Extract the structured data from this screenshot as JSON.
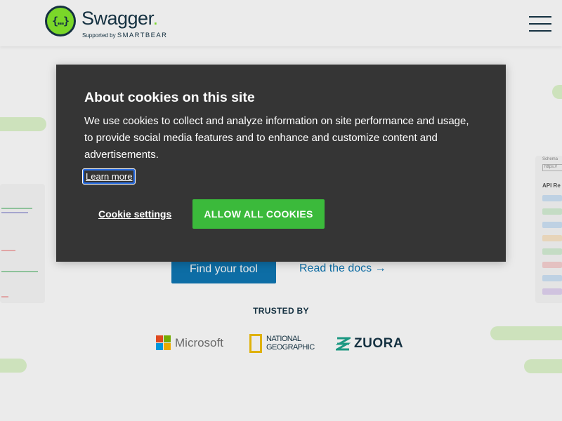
{
  "header": {
    "logo_glyph": "{…}",
    "logo_word": "Swagger",
    "logo_tm": ".",
    "supported_by": "Supported by",
    "smartbear": "SMARTBEAR"
  },
  "hero": {
    "find_tool_label": "Find your tool",
    "read_docs_label": "Read the docs",
    "read_docs_arrow": "→"
  },
  "trusted": {
    "heading": "TRUSTED BY",
    "logos": {
      "microsoft": "Microsoft",
      "natgeo_line1": "NATIONAL",
      "natgeo_line2": "GEOGRAPHIC",
      "zuora": "ZUORA"
    }
  },
  "side_card_right": {
    "label_top": "Schema",
    "field_text": "https://",
    "section_title": "API Re"
  },
  "cookie_banner": {
    "title": "About cookies on this site",
    "body": "We use cookies to collect and analyze information on site performance and usage, to provide social media features and to enhance and customize content and advertisements.",
    "learn_more": "Learn more",
    "settings_label": "Cookie settings",
    "allow_label": "ALLOW ALL COOKIES"
  },
  "colors": {
    "brand_green": "#85ea2d",
    "navy": "#173647",
    "link_blue": "#0f77b4",
    "banner_bg": "#353535",
    "accept_green": "#3bba3b"
  }
}
